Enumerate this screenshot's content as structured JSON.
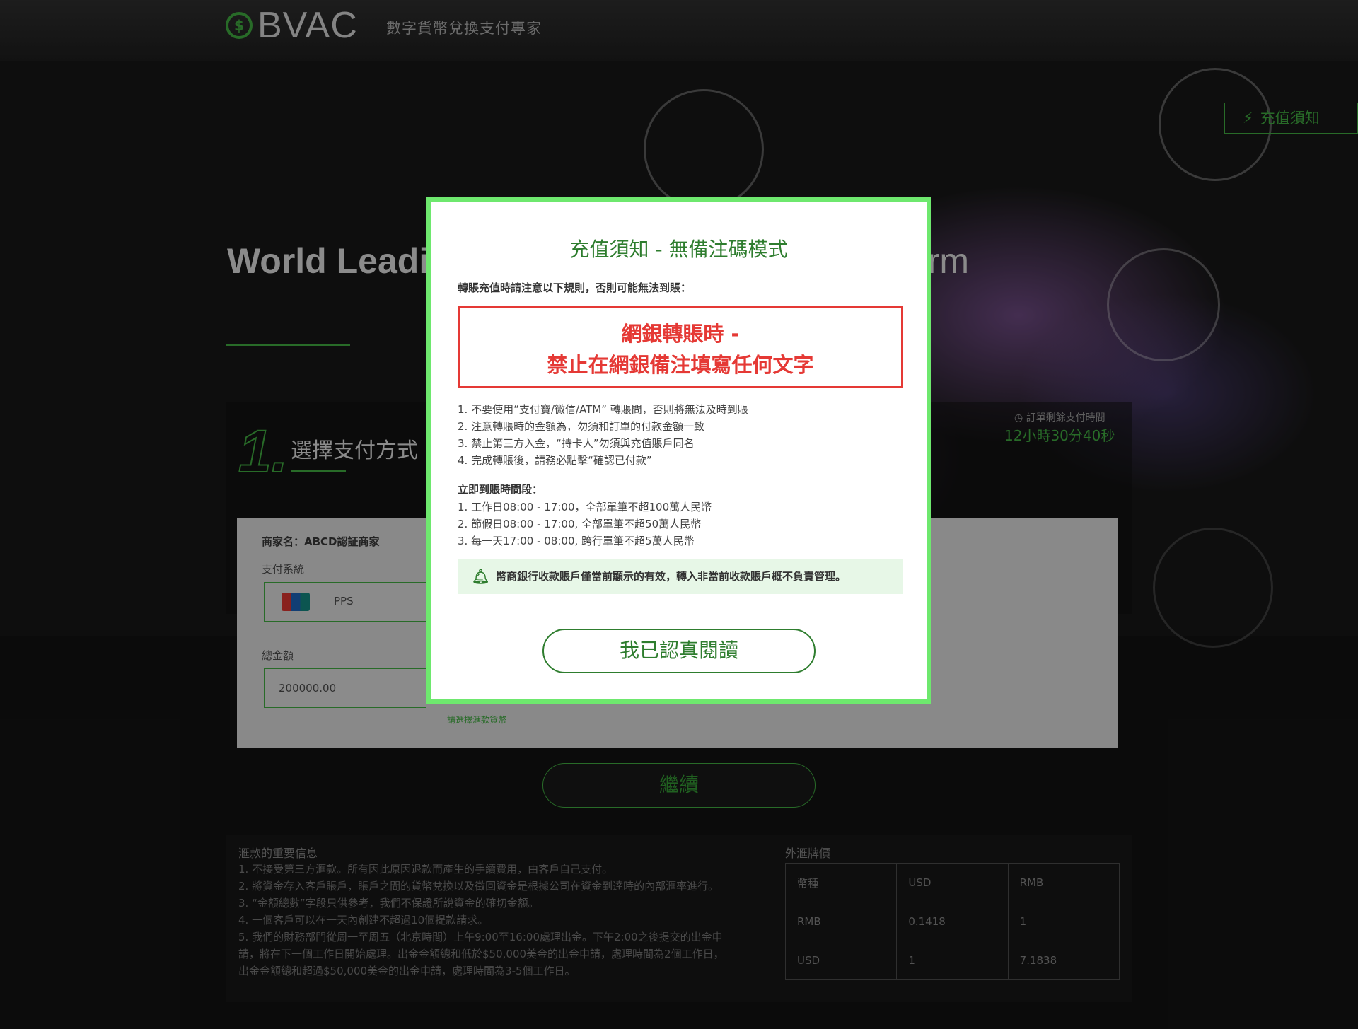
{
  "header": {
    "logo_symbol": "$",
    "logo_text": "BVAC",
    "tagline": "數字貨幣兌換支付專家"
  },
  "hero": {
    "title_left": "World Leadi",
    "title_right": "form",
    "notice_button": "充值須知"
  },
  "step": {
    "number": "1.",
    "label": "選擇支付方式"
  },
  "timer": {
    "label": "訂單剩餘支付時間",
    "value": "12小時30分40秒"
  },
  "form": {
    "merchant": "商家名：ABCD認証商家",
    "payment_system_label": "支付系統",
    "payment_system_value": "PPS",
    "total_label": "總金額",
    "total_value": "200000.00",
    "currency_hint": "請選擇滙款貨幣"
  },
  "continue_button": "繼續",
  "info": {
    "title": "滙款的重要信息",
    "lines": [
      "1. 不接受第三方滙款。所有因此原因退款而產生的手續費用，由客戶自己支付。",
      "2. 將資金存入客戶賬戶，賬戶之間的貨幣兌換以及徵回資金是根據公司在資金到達時的內部滙率進行。",
      "3. “金額總數”字段只供參考，我們不保證所說資金的確切金額。",
      "4. 一個客戶可以在一天內創建不超過10個提款請求。",
      "5. 我們的財務部門從周一至周五（北京時間）上午9:00至16:00處理出金。下午2:00之後提交的出金申",
      "請，將在下一個工作日開始處理。出金金額總和低於$50,000美金的出金申請，處理時間為2個工作日，",
      "出金金額總和超過$50,000美金的出金申請，處理時間為3-5個工作日。"
    ]
  },
  "fx": {
    "title": "外滙牌價",
    "rows": [
      [
        "幣種",
        "USD",
        "RMB"
      ],
      [
        "RMB",
        "0.1418",
        "1"
      ],
      [
        "USD",
        "1",
        "7.1838"
      ]
    ]
  },
  "modal": {
    "title": "充值須知 - 無備注碼模式",
    "intro": "轉賬充值時請注意以下規則，否則可能無法到賬：",
    "warning_line1": "網銀轉賬時 -",
    "warning_line2": "禁止在網銀備注填寫任何文字",
    "rules": [
      "1. 不要使用“支付寶/微信/ATM” 轉賬問，否則將無法及時到賬",
      "2. 注意轉賬時的金額為，勿須和訂單的付款金額一致",
      "3. 禁止第三方入金，“持卡人”勿須與充值賬戶同名",
      "4. 完成轉賬後，請務必點擊“確認已付款”"
    ],
    "period_title": "立即到賬時間段：",
    "periods": [
      "1. 工作日08:00 - 17:00，全部單筆不超100萬人民幣",
      "2. 節假日08:00 - 17:00, 全部單筆不超50萬人民幣",
      "3. 每一天17:00 - 08:00, 跨行單筆不超5萬人民幣"
    ],
    "tip": "幣商銀行收款賬戶僅當前顯示的有效，轉入非當前收款賬戶概不負責管理。",
    "confirm_button": "我已認真閱讀"
  },
  "colors": {
    "brand_green": "#3a9a3a",
    "modal_border": "#6ee86e",
    "warning_red": "#e53935"
  }
}
